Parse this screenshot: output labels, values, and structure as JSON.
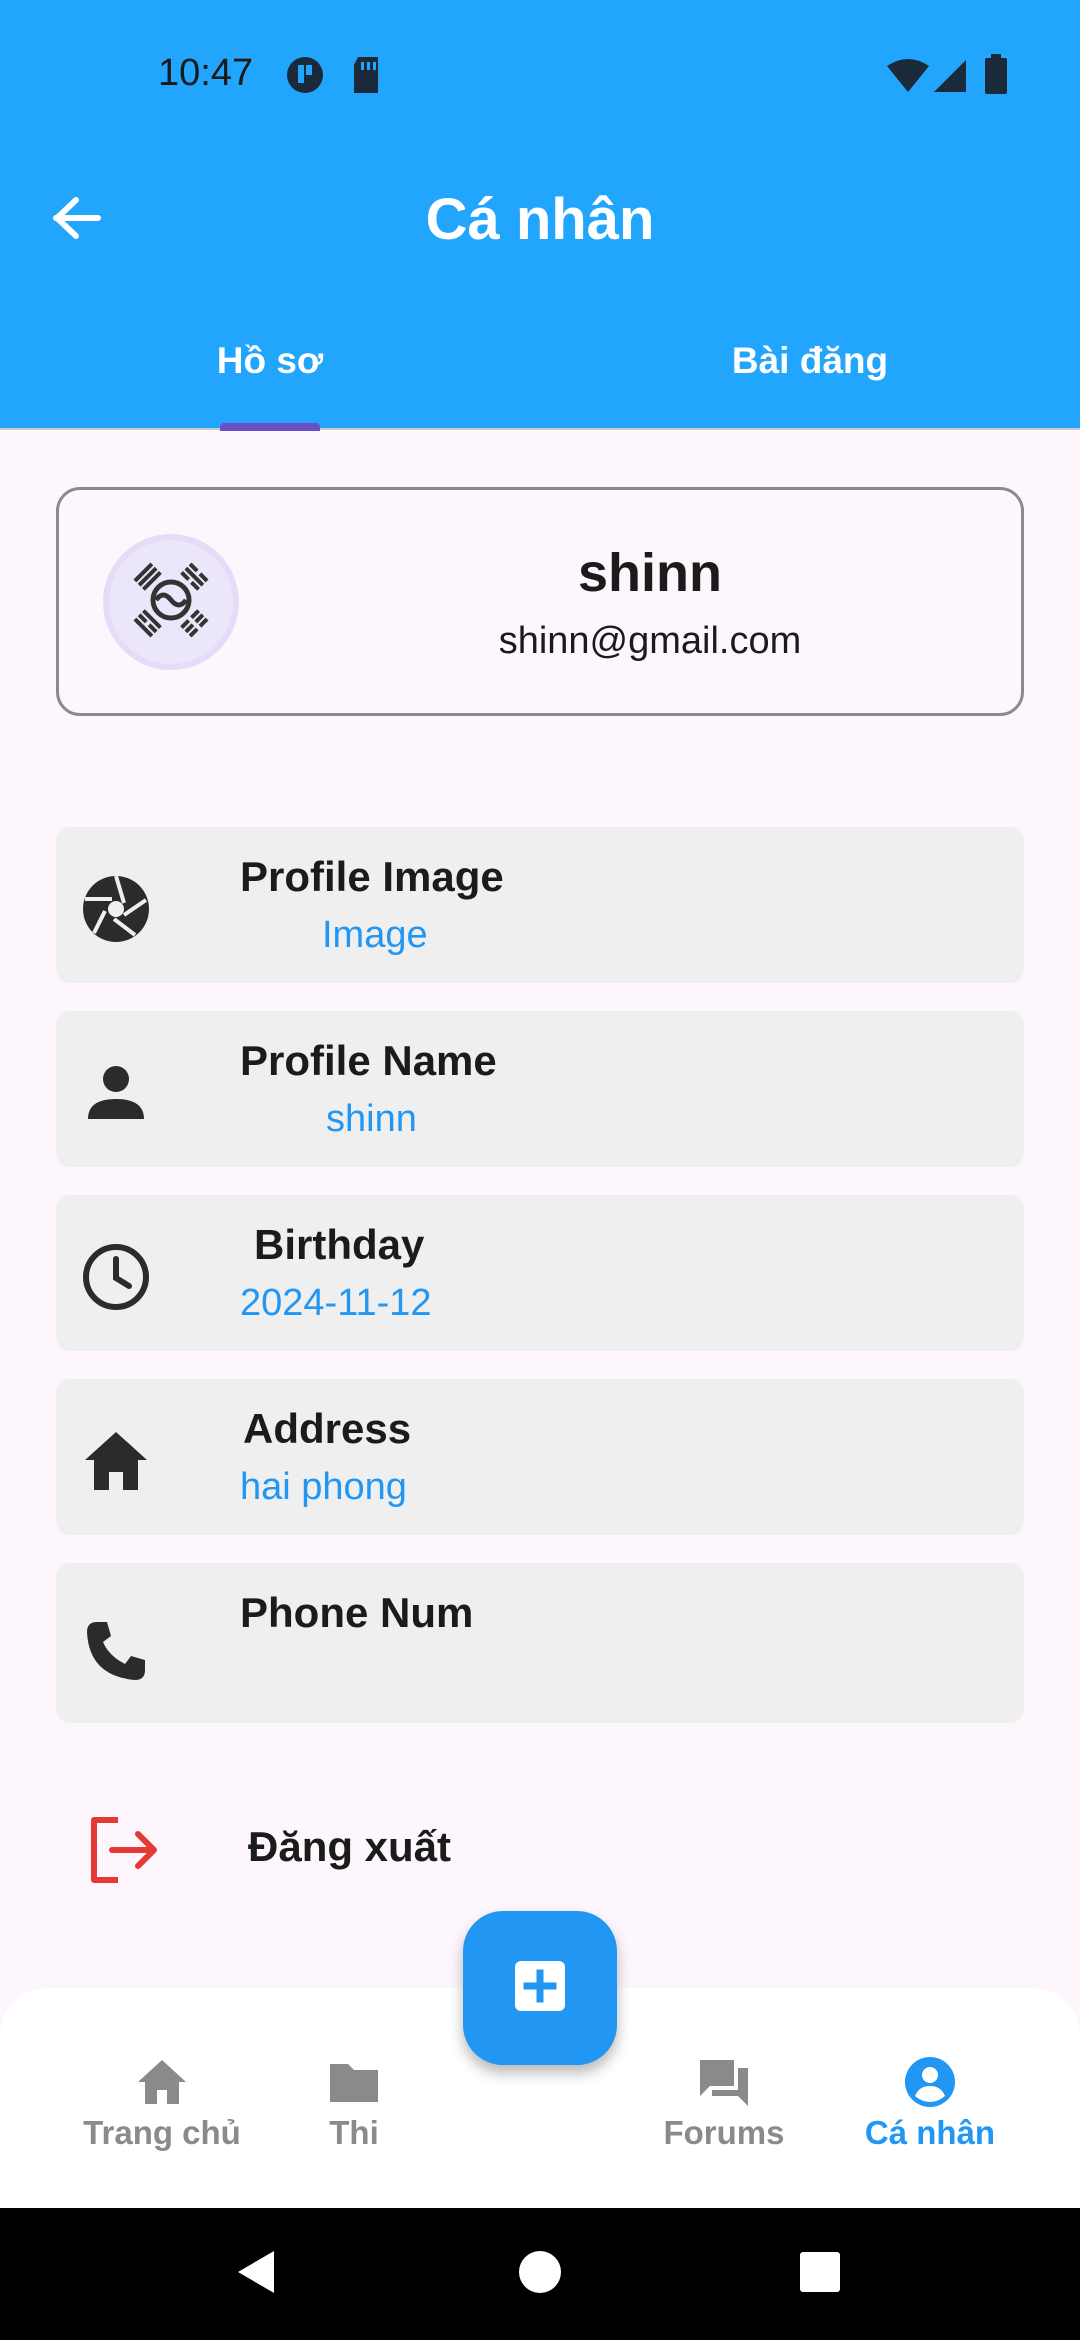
{
  "status_bar": {
    "time": "10:47",
    "icons": [
      "app-notification-icon",
      "sd-card-icon",
      "wifi-icon",
      "signal-icon",
      "battery-icon"
    ]
  },
  "app_bar": {
    "title": "Cá nhân",
    "back_icon": "arrow-left-icon"
  },
  "tabs": [
    {
      "label": "Hồ sơ",
      "active": true
    },
    {
      "label": "Bài đăng",
      "active": false
    }
  ],
  "profile": {
    "name": "shinn",
    "email": "shinn@gmail.com",
    "avatar_icon": "korean-flag-emblem-icon"
  },
  "info_rows": [
    {
      "label": "Profile Image",
      "value": "Image",
      "icon": "camera-aperture-icon"
    },
    {
      "label": "Profile Name",
      "value": "shinn",
      "icon": "person-icon"
    },
    {
      "label": "Birthday",
      "value": "2024-11-12",
      "icon": "clock-icon"
    },
    {
      "label": "Address",
      "value": "hai phong",
      "icon": "home-icon"
    },
    {
      "label": "Phone Num",
      "value": "",
      "icon": "phone-icon"
    }
  ],
  "logout": {
    "label": "Đăng xuất",
    "icon": "logout-icon",
    "color": "#e53935"
  },
  "bottom_nav": [
    {
      "label": "Trang chủ",
      "icon": "home-icon",
      "active": false
    },
    {
      "label": "Thi",
      "icon": "folder-icon",
      "active": false
    },
    {
      "label": "Forums",
      "icon": "forum-icon",
      "active": false
    },
    {
      "label": "Cá nhân",
      "icon": "account-circle-icon",
      "active": true
    }
  ],
  "fab": {
    "icon": "add-box-icon"
  },
  "colors": {
    "primary": "#22a5fd",
    "accent": "#2196f3",
    "tab_indicator": "#6a4fc8",
    "background": "#fdf7fd",
    "row_background": "#efefef"
  }
}
